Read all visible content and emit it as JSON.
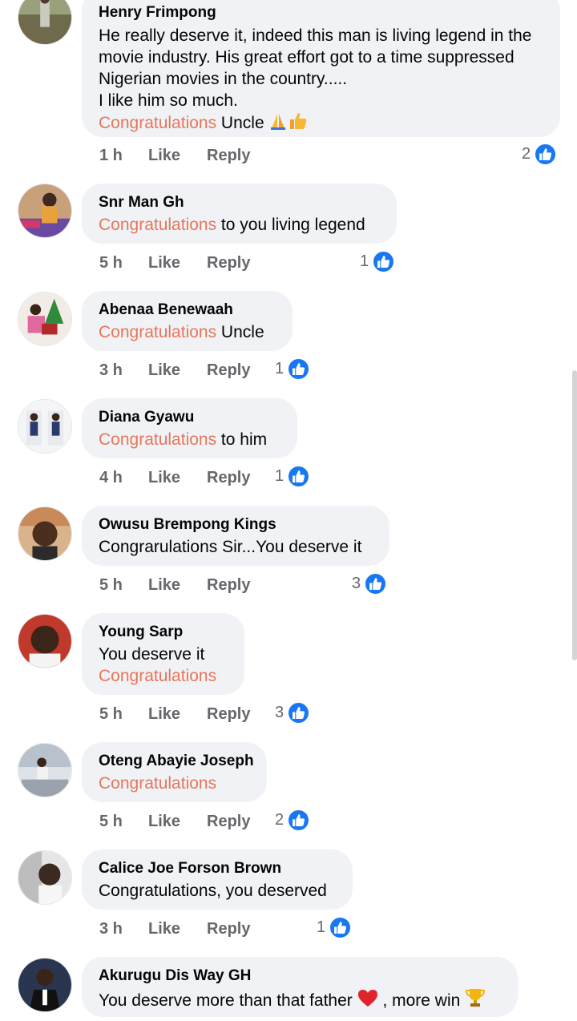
{
  "comments": [
    {
      "author": "Henry Frimpong",
      "lines": [
        "He really deserve it, indeed this man is living legend in the",
        "movie industry. His great effort got to a time suppressed",
        "Nigerian movies in the country.....",
        "I like him so much."
      ],
      "keyword": "Congratulations",
      "after": " Uncle ",
      "emojis": [
        "folded-hands-emoji",
        "thumbs-up-emoji"
      ],
      "time": "1 h",
      "like": "Like",
      "reply": "Reply",
      "reactions": "2"
    },
    {
      "author": "Snr Man Gh",
      "keyword": "Congratulations",
      "after": " to you living legend",
      "time": "5 h",
      "like": "Like",
      "reply": "Reply",
      "reactions": "1"
    },
    {
      "author": "Abenaa Benewaah",
      "keyword": "Congratulations",
      "after": " Uncle",
      "time": "3 h",
      "like": "Like",
      "reply": "Reply",
      "reactions": "1"
    },
    {
      "author": "Diana Gyawu",
      "keyword": "Congratulations",
      "after": " to him",
      "time": "4 h",
      "like": "Like",
      "reply": "Reply",
      "reactions": "1"
    },
    {
      "author": "Owusu Brempong Kings",
      "text": "Congrarulations Sir...You deserve it",
      "time": "5 h",
      "like": "Like",
      "reply": "Reply",
      "reactions": "3"
    },
    {
      "author": "Young Sarp",
      "text": "You deserve it",
      "keyword": "Congratulations",
      "time": "5 h",
      "like": "Like",
      "reply": "Reply",
      "reactions": "3"
    },
    {
      "author": "Oteng Abayie Joseph",
      "keyword": "Congratulations",
      "time": "5 h",
      "like": "Like",
      "reply": "Reply",
      "reactions": "2"
    },
    {
      "author": "Calice Joe Forson Brown",
      "text": "Congratulations, you deserved",
      "time": "3 h",
      "like": "Like",
      "reply": "Reply",
      "reactions": "1"
    },
    {
      "author": "Akurugu Dis Way GH",
      "text": "You deserve more than that father",
      "after": " , more win ",
      "emojis": [
        "red-heart-emoji",
        "trophy-emoji"
      ]
    }
  ],
  "colors": {
    "keyword": "#e8765a",
    "bubble": "#f0f2f5",
    "like_badge": "#1877f2",
    "meta": "#65676b"
  }
}
